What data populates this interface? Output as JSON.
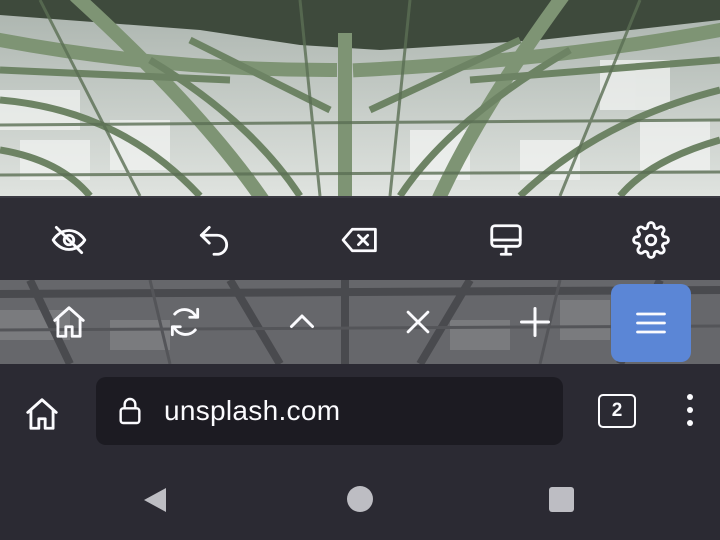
{
  "top_toolbar": {
    "icons": [
      "eye-slash-icon",
      "undo-icon",
      "backspace-icon",
      "desktop-icon",
      "gear-icon"
    ]
  },
  "mid_toolbar": {
    "icons": [
      "home-icon",
      "refresh-icon",
      "chevron-up-icon",
      "close-icon",
      "plus-icon",
      "menu-icon"
    ],
    "menu_accent": "#5b86d6"
  },
  "browser": {
    "url": "unsplash.com",
    "tab_count": "2",
    "icons": [
      "home-icon",
      "lock-icon",
      "tabs-icon",
      "kebab-menu-icon"
    ]
  },
  "navbar": {
    "icons": [
      "back-triangle-icon",
      "home-circle-icon",
      "recents-square-icon"
    ]
  },
  "colors": {
    "toolbar_bg": "#2e2d35",
    "url_field_bg": "#1c1b22",
    "text": "#fbfbfe"
  }
}
